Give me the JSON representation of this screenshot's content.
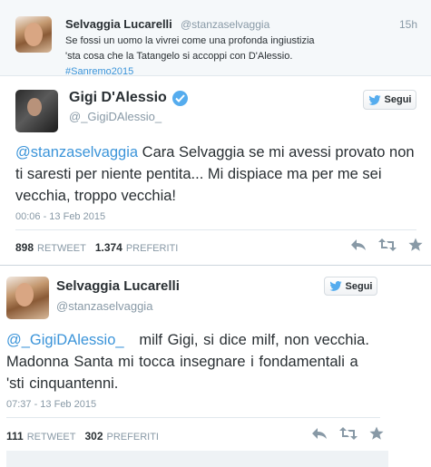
{
  "reply": {
    "name": "Selvaggia Lucarelli",
    "handle": "@stanzaselvaggia",
    "time": "15h",
    "text_before": "Se fossi un uomo la vivrei come una profonda ingiustizia 'sta cosa che la Tatangelo si accoppi con D'Alessio.",
    "hashtag": "#Sanremo2015"
  },
  "tweet1": {
    "name": "Gigi D'Alessio",
    "handle": "@_GigiDAlessio_",
    "follow_label": "Segui",
    "mention": "@stanzaselvaggia",
    "text": "Cara Selvaggia se mi avessi provato non ti saresti per niente pentita... Mi dispiace ma per me sei vecchia, troppo vecchia!",
    "timestamp": "00:06 - 13 Feb 2015",
    "retweets": "898",
    "retweets_label": "RETWEET",
    "favorites": "1.374",
    "favorites_label": "PREFERITI"
  },
  "tweet2": {
    "name": "Selvaggia Lucarelli",
    "handle": "@stanzaselvaggia",
    "follow_label": "Segui",
    "mention": "@_GigiDAlessio_",
    "text": "milf Gigi, si dice milf, non vecchia. Madonna Santa mi tocca insegnare i fondamentali a 'sti cinquantenni.",
    "timestamp": "07:37 - 13 Feb 2015",
    "retweets": "111",
    "retweets_label": "RETWEET",
    "favorites": "302",
    "favorites_label": "PREFERITI"
  },
  "colors": {
    "link": "#3b94d9",
    "verified": "#55acee",
    "muted": "#8899a6"
  },
  "icons": [
    "reply-icon",
    "retweet-icon",
    "favorite-icon",
    "twitter-bird-icon",
    "verified-icon"
  ]
}
